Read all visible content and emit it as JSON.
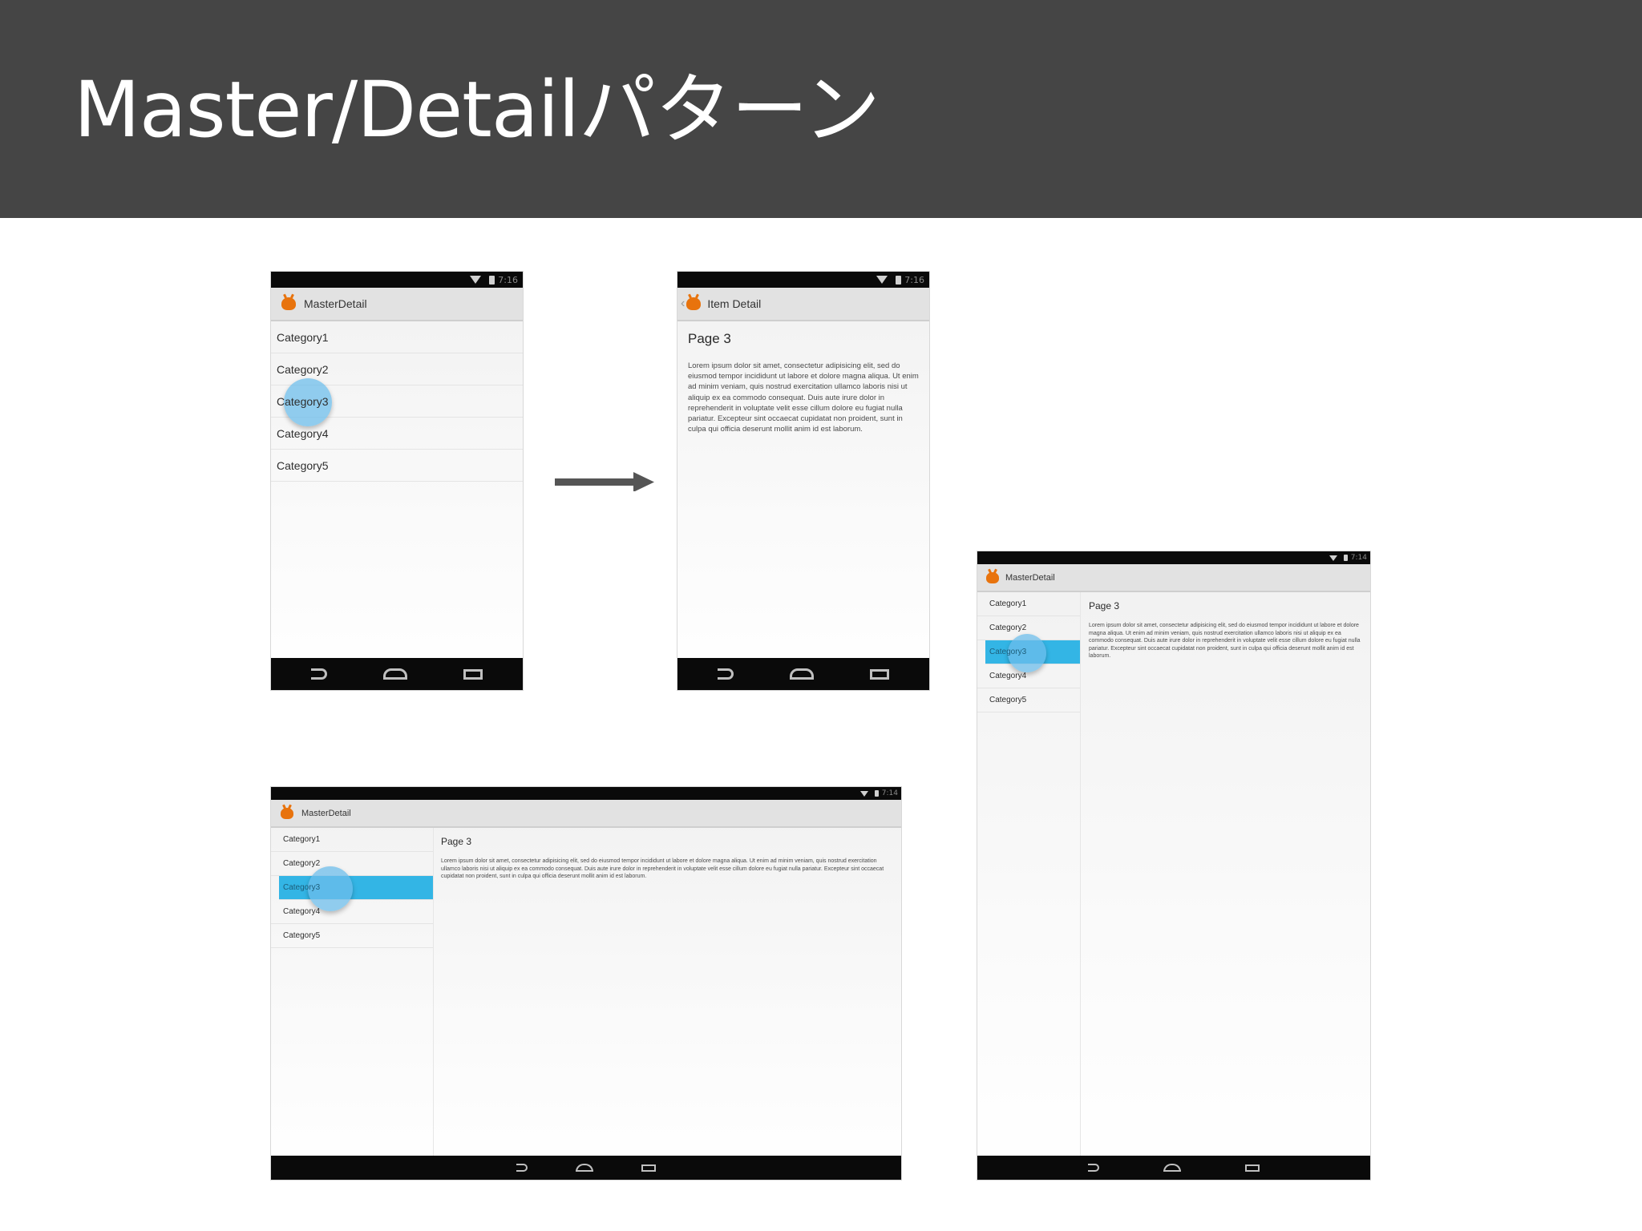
{
  "slide": {
    "title": "Master/Detailパターン"
  },
  "status_time": "7:16",
  "status_time_tablet": "7:14",
  "phone_master": {
    "app_title": "MasterDetail",
    "items": [
      "Category1",
      "Category2",
      "Category3",
      "Category4",
      "Category5"
    ],
    "selected_index": 2
  },
  "phone_detail": {
    "app_title": "Item Detail",
    "page_title": "Page 3",
    "body": "Lorem ipsum dolor sit amet, consectetur adipisicing elit, sed do eiusmod tempor incididunt ut labore et dolore magna aliqua. Ut enim ad minim veniam, quis nostrud exercitation ullamco laboris nisi ut aliquip ex ea commodo consequat. Duis aute irure dolor in reprehenderit in voluptate velit esse cillum dolore eu fugiat nulla pariatur. Excepteur sint occaecat cupidatat non proident, sunt in culpa qui officia deserunt mollit anim id est laborum."
  },
  "tablet_landscape": {
    "app_title": "MasterDetail",
    "items": [
      "Category1",
      "Category2",
      "Category3",
      "Category4",
      "Category5"
    ],
    "selected_index": 2,
    "page_title": "Page 3",
    "body": "Lorem ipsum dolor sit amet, consectetur adipisicing elit, sed do eiusmod tempor incididunt ut labore et dolore magna aliqua. Ut enim ad minim veniam, quis nostrud exercitation ullamco laboris nisi ut aliquip ex ea commodo consequat. Duis aute irure dolor in reprehenderit in voluptate velit esse cillum dolore eu fugiat nulla pariatur. Excepteur sint occaecat cupidatat non proident, sunt in culpa qui officia deserunt mollit anim id est laborum."
  },
  "tablet_portrait": {
    "app_title": "MasterDetail",
    "items": [
      "Category1",
      "Category2",
      "Category3",
      "Category4",
      "Category5"
    ],
    "selected_index": 2,
    "page_title": "Page 3",
    "body": "Lorem ipsum dolor sit amet, consectetur adipisicing elit, sed do eiusmod tempor incididunt ut labore et dolore magna aliqua. Ut enim ad minim veniam, quis nostrud exercitation ullamco laboris nisi ut aliquip ex ea commodo consequat. Duis aute irure dolor in reprehenderit in voluptate velit esse cillum dolore eu fugiat nulla pariatur. Excepteur sint occaecat cupidatat non proident, sunt in culpa qui officia deserunt mollit anim id est laborum."
  },
  "colors": {
    "header_bg": "#454545",
    "selection": "#33b5e5",
    "touch_ripple": "#6ebeeb",
    "android_logo": "#e8730d",
    "arrow": "#555555"
  },
  "icons": [
    "wifi-icon",
    "battery-icon",
    "android-icon",
    "nav-back-icon",
    "nav-home-icon",
    "nav-recent-icon",
    "arrow-right-icon"
  ]
}
